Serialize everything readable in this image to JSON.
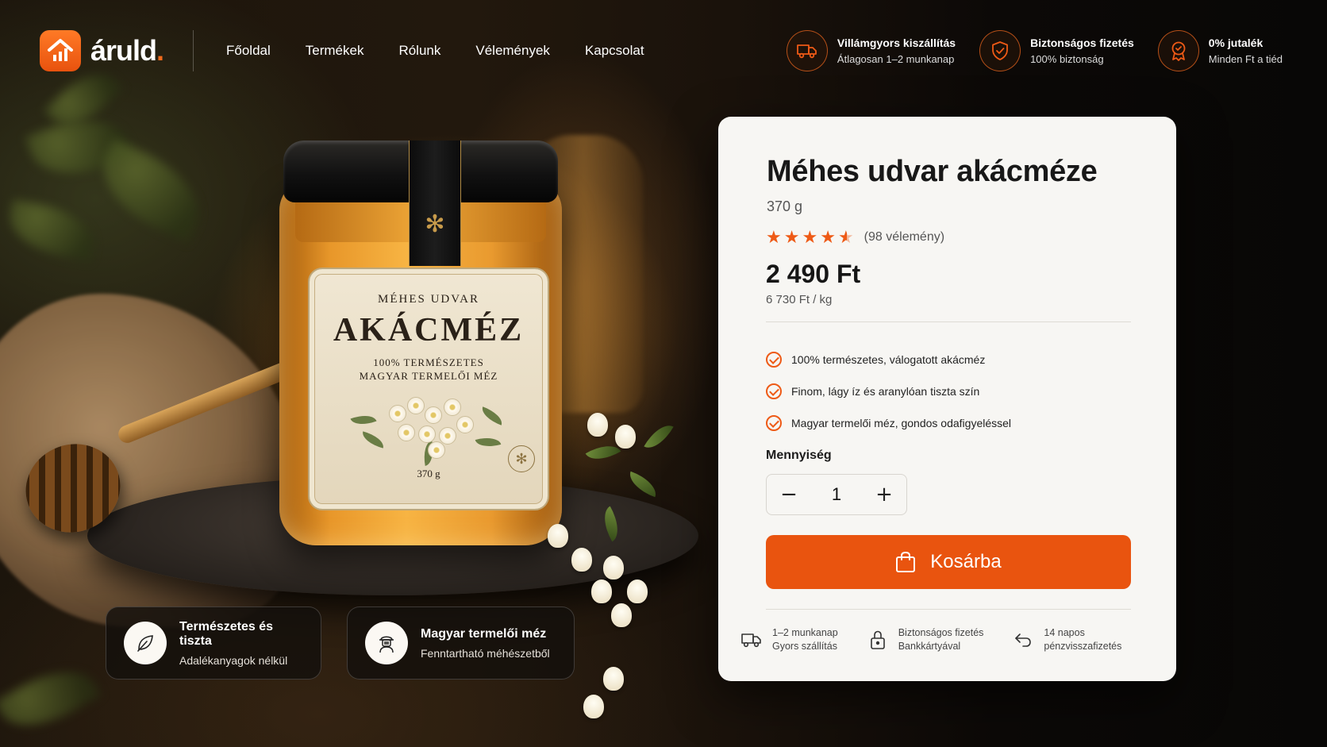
{
  "brand": {
    "name": "áruld",
    "dot": ".",
    "accent": "#f26a1b"
  },
  "nav": {
    "items": [
      "Főoldal",
      "Termékek",
      "Rólunk",
      "Vélemények",
      "Kapcsolat"
    ]
  },
  "perks": [
    {
      "icon": "truck-icon",
      "title": "Villámgyors kiszállítás",
      "sub": "Átlagosan 1–2 munkanap"
    },
    {
      "icon": "shield-check-icon",
      "title": "Biztonságos fizetés",
      "sub": "100% biztonság"
    },
    {
      "icon": "badge-icon",
      "title": "0% jutalék",
      "sub": "Minden Ft a tiéd"
    }
  ],
  "jar_label": {
    "brand": "MÉHES UDVAR",
    "name": "AKÁCMÉZ",
    "sub1": "100% TERMÉSZETES",
    "sub2": "MAGYAR TERMELŐI MÉZ",
    "weight": "370 g"
  },
  "pills": [
    {
      "icon": "leaf-icon",
      "title": "Természetes és tiszta",
      "sub": "Adalékanyagok nélkül"
    },
    {
      "icon": "beekeeper-icon",
      "title": "Magyar termelői méz",
      "sub": "Fenntartható méhészetből"
    }
  ],
  "product": {
    "title": "Méhes udvar akácméze",
    "weight": "370 g",
    "rating": 4.5,
    "reviews": "(98 vélemény)",
    "price": "2 490 Ft",
    "unit_price": "6 730 Ft / kg",
    "features": [
      "100% természetes, válogatott akácméz",
      "Finom, lágy íz és aranylóan tiszta szín",
      "Magyar termelői méz, gondos odafigyeléssel"
    ],
    "quantity_label": "Mennyiség",
    "quantity": "1",
    "minus": "−",
    "plus": "+",
    "cart_label": "Kosárba",
    "accent": "#e9540f"
  },
  "card_footer": [
    {
      "icon": "delivery-truck-icon",
      "line1": "1–2 munkanap",
      "line2": "Gyors szállítás"
    },
    {
      "icon": "lock-icon",
      "line1": "Biztonságos fizetés",
      "line2": "Bankkártyával"
    },
    {
      "icon": "return-arrow-icon",
      "line1": "14 napos",
      "line2": "pénzvisszafizetés"
    }
  ]
}
